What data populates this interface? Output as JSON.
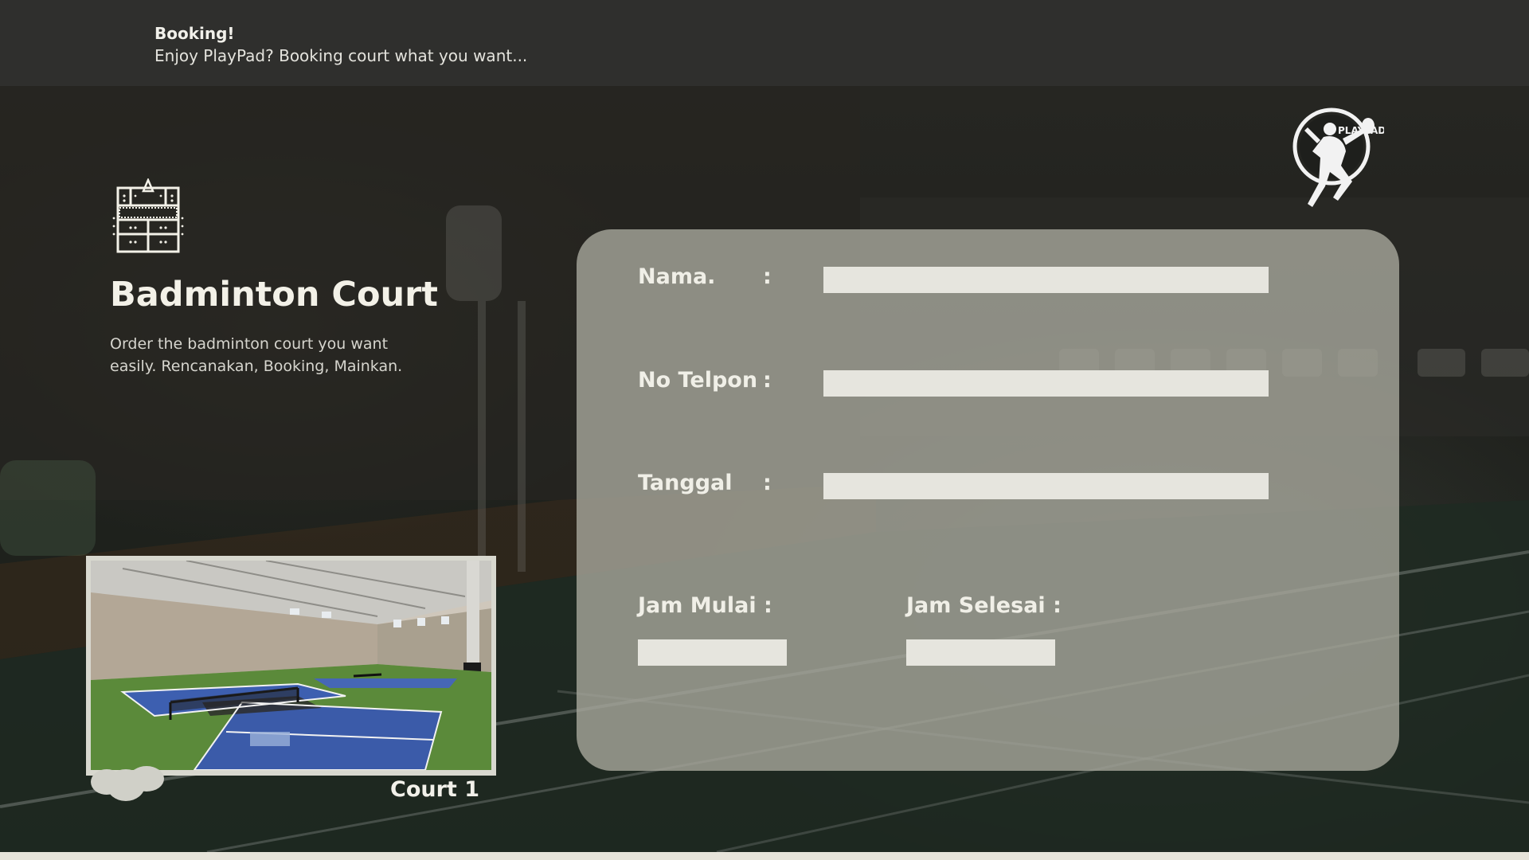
{
  "header": {
    "title": "Booking!",
    "subtitle": "Enjoy PlayPad? Booking court what you want..."
  },
  "hero": {
    "icon": "badminton-court-icon",
    "title": "Badminton Court",
    "description": "Order the badminton court you want easily. Rencanakan, Booking, Mainkan."
  },
  "gallery": {
    "caption": "Court 1"
  },
  "logo": {
    "text": "PLAYPAD",
    "icon": "badminton-player-logo"
  },
  "form": {
    "nama_label": "Nama.",
    "telpon_label": "No Telpon",
    "tanggal_label": "Tanggal",
    "colon": ":",
    "jam_mulai_label": "Jam Mulai :",
    "jam_selesai_label": "Jam Selesai :",
    "nama_value": "",
    "telpon_value": "",
    "tanggal_value": "",
    "jam_mulai_value": "",
    "jam_selesai_value": ""
  },
  "colors": {
    "header_bg": "#2f2f2d",
    "panel_bg": "#a8a79c",
    "input_bg": "#e6e5de",
    "text_light": "#f0efe7"
  }
}
